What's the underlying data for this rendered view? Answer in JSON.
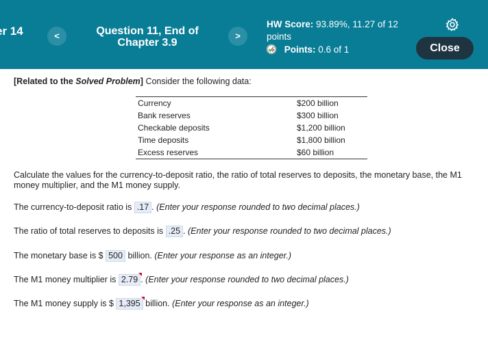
{
  "header": {
    "chapter_fragment": "er 14",
    "prev_label": "<",
    "next_label": ">",
    "question_title": "Question 11, End of Chapter 3.9",
    "hw_score_label": "HW Score:",
    "hw_score_value": "93.89%, 11.27 of 12 points",
    "points_label": "Points:",
    "points_value": "0.6 of 1",
    "close_label": "Close"
  },
  "problem": {
    "intro_bold": "[Related to the",
    "intro_italic": "Solved Problem",
    "intro_bold_end": "]",
    "intro_text": "Consider the following data:",
    "data_rows": [
      {
        "label": "Currency",
        "value": "$200 billion"
      },
      {
        "label": "Bank reserves",
        "value": "$300 billion"
      },
      {
        "label": "Checkable deposits",
        "value": "$1,200 billion"
      },
      {
        "label": "Time deposits",
        "value": "$1,800 billion"
      },
      {
        "label": "Excess reserves",
        "value": "$60 billion"
      }
    ],
    "question_text": "Calculate the values for the currency-to-deposit ratio, the ratio of total reserves to deposits, the monetary base, the M1 money multiplier, and the M1 money supply."
  },
  "answers": [
    {
      "prefix": "The currency-to-deposit ratio is",
      "value": ".17",
      "suffix": ".",
      "note": "(Enter your response rounded to two decimal places.)"
    },
    {
      "prefix": "The ratio of total reserves to deposits is",
      "value": ".25",
      "suffix": ".",
      "note": "(Enter your response rounded to two decimal places.)"
    },
    {
      "prefix": "The monetary base is $",
      "value": "500",
      "suffix": "billion.",
      "note": "(Enter your response as an integer.)"
    },
    {
      "prefix": "The M1 money multiplier is",
      "value": "2.79",
      "suffix": ".",
      "note": "(Enter your response rounded to two decimal places.)"
    },
    {
      "prefix": "The M1 money supply is $",
      "value": "1,395",
      "suffix": "billion.",
      "note": "(Enter your response as an integer.)"
    }
  ]
}
